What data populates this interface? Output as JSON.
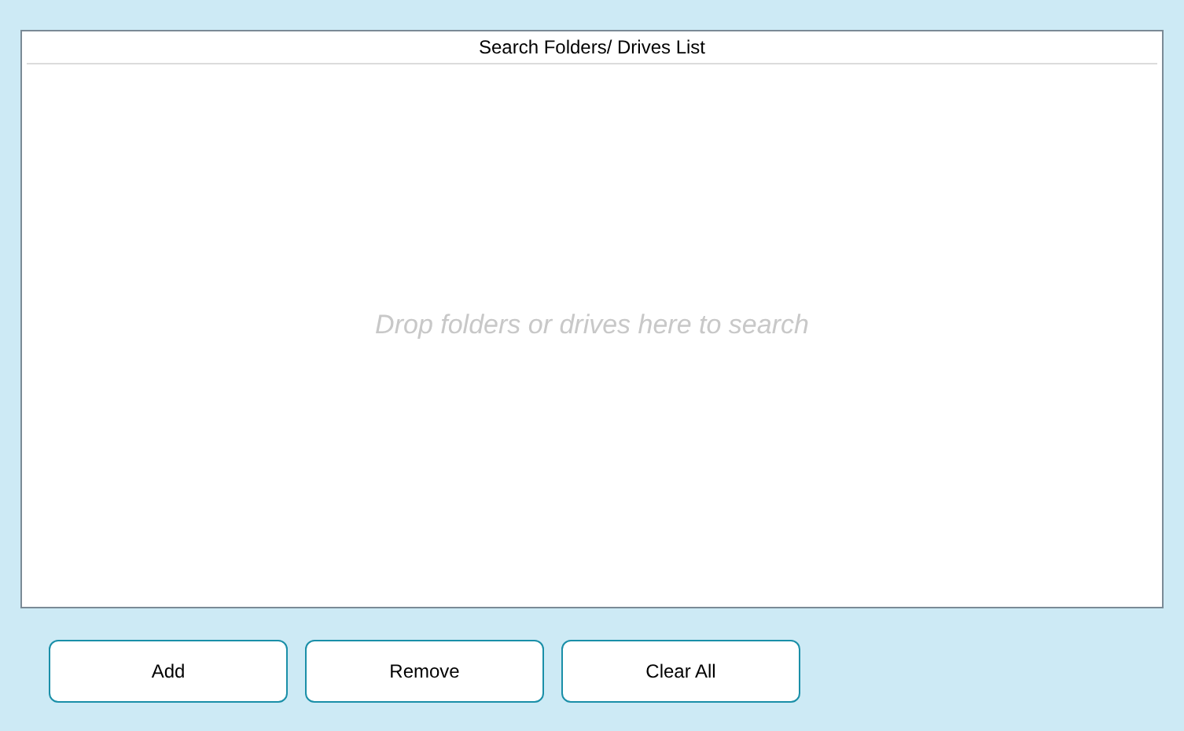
{
  "list": {
    "header": "Search Folders/ Drives List",
    "placeholder": "Drop folders or drives here to search"
  },
  "buttons": [
    "Add",
    "Remove",
    "Clear All"
  ]
}
